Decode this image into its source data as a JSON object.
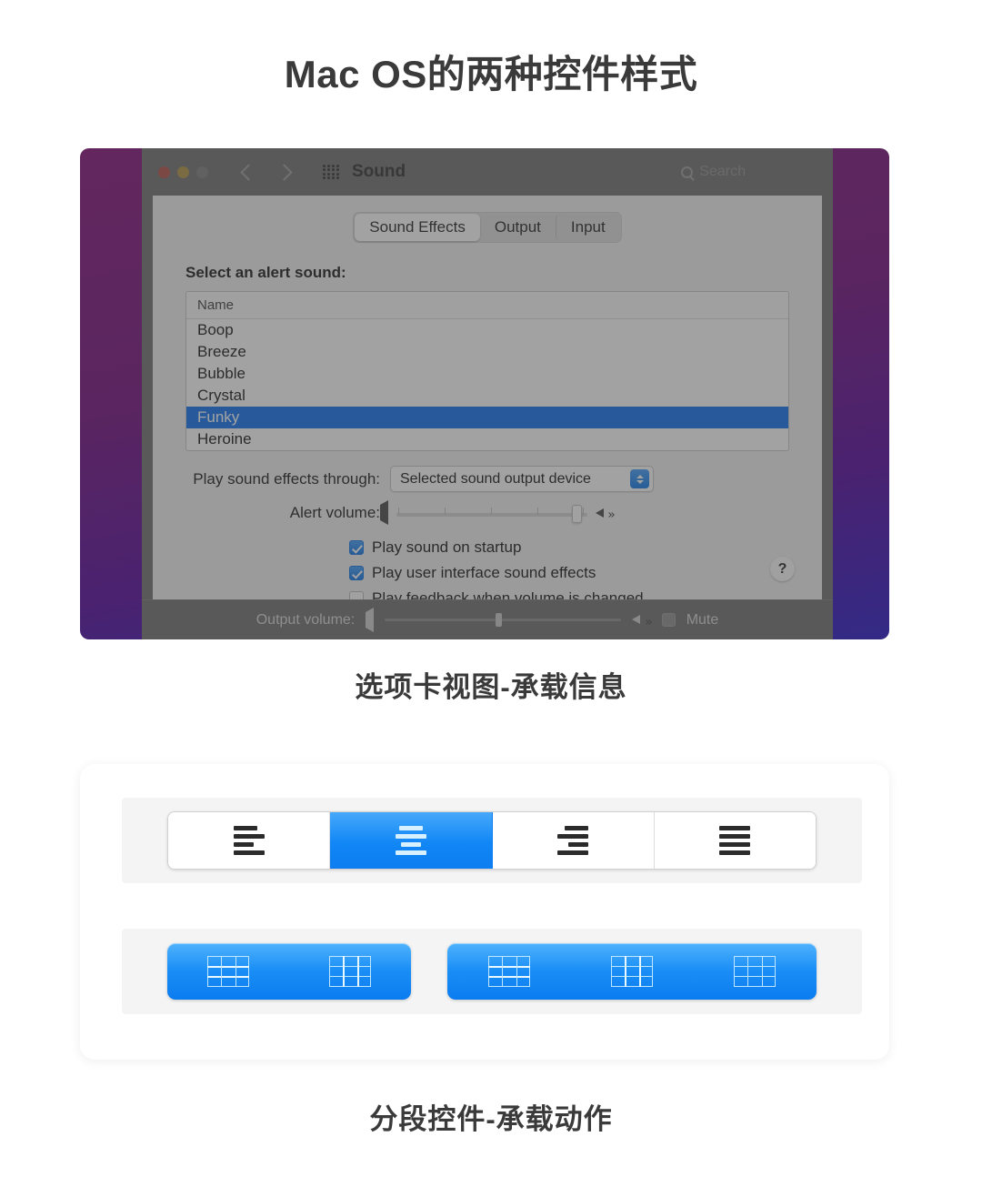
{
  "page": {
    "title": "Mac OS的两种控件样式",
    "caption_tabs": "选项卡视图-承载信息",
    "caption_segmented": "分段控件-承载动作"
  },
  "colors": {
    "accent_blue": "#0a6ef0",
    "segment_blue_top": "#46a9fb",
    "segment_blue_bottom": "#0d7ef1",
    "title_gray": "#3a3a3a",
    "window_chrome": "#6d6d6d",
    "pane_bg": "#f2f0f0",
    "wallpaper_purple": "#5a2560",
    "wallpaper_indigo": "#332a86"
  },
  "mac_window": {
    "toolbar": {
      "traffic_lights": [
        "close-red",
        "minimize-yellow",
        "zoom-disabled"
      ],
      "back_icon": "chevron-left-icon",
      "forward_icon": "chevron-right-icon",
      "grid_icon": "grid-dots-icon",
      "title": "Sound",
      "search_icon": "search-icon",
      "search_placeholder": "Search"
    },
    "tabs": [
      {
        "label": "Sound Effects",
        "active": true
      },
      {
        "label": "Output",
        "active": false
      },
      {
        "label": "Input",
        "active": false
      }
    ],
    "select_label": "Select an alert sound:",
    "list": {
      "column_header": "Name",
      "rows": [
        {
          "name": "Boop",
          "selected": false
        },
        {
          "name": "Breeze",
          "selected": false
        },
        {
          "name": "Bubble",
          "selected": false
        },
        {
          "name": "Crystal",
          "selected": false
        },
        {
          "name": "Funky",
          "selected": true
        },
        {
          "name": "Heroine",
          "selected": false
        }
      ]
    },
    "output_device": {
      "label": "Play sound effects through:",
      "value": "Selected sound output device",
      "arrows_icon": "chevron-up-down-icon"
    },
    "alert_volume": {
      "label": "Alert volume:",
      "min_icon": "speaker-quiet-icon",
      "max_icon": "speaker-loud-icon",
      "value_percent": 95,
      "tick_count": 5
    },
    "checkboxes": [
      {
        "label": "Play sound on startup",
        "checked": true
      },
      {
        "label": "Play user interface sound effects",
        "checked": true
      },
      {
        "label": "Play feedback when volume is changed",
        "checked": false
      }
    ],
    "help_button": "?",
    "bottom_bar": {
      "label": "Output volume:",
      "min_icon": "speaker-quiet-icon",
      "max_icon": "speaker-loud-icon",
      "mute_label": "Mute",
      "mute_checked": false
    }
  },
  "segmented": {
    "alignment": {
      "options": [
        {
          "icon": "align-left-icon",
          "active": false
        },
        {
          "icon": "align-center-icon",
          "active": true
        },
        {
          "icon": "align-right-icon",
          "active": false
        },
        {
          "icon": "align-justify-icon",
          "active": false
        }
      ]
    },
    "grid_two": {
      "options": [
        {
          "icon": "table-row-highlight-icon",
          "active": true
        },
        {
          "icon": "table-column-highlight-icon",
          "active": true
        }
      ]
    },
    "grid_three": {
      "options": [
        {
          "icon": "table-row-highlight-icon",
          "active": true
        },
        {
          "icon": "table-column-highlight-icon",
          "active": true
        },
        {
          "icon": "table-plain-icon",
          "active": true
        }
      ]
    }
  }
}
